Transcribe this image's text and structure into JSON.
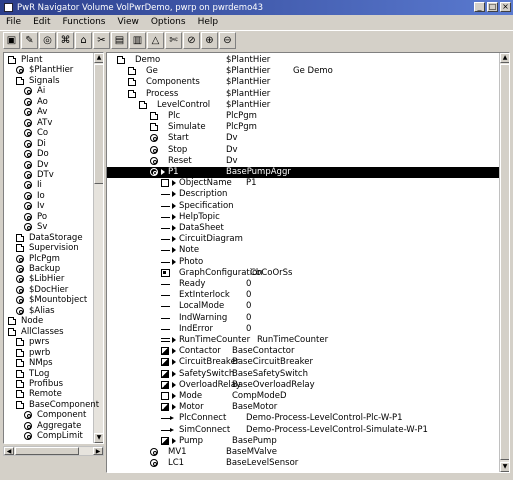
{
  "window": {
    "title": "PwR Navigator Volume VolPwrDemo, pwrp on pwrdemo43",
    "buttons": [
      "_",
      "□",
      "×"
    ]
  },
  "menu": [
    "File",
    "Edit",
    "Functions",
    "View",
    "Options",
    "Help"
  ],
  "toolbar": [
    {
      "icon": "save-icon",
      "glyph": "▣"
    },
    {
      "icon": "edit-icon",
      "glyph": "✎"
    },
    {
      "icon": "open-object-icon",
      "glyph": "◎"
    },
    {
      "icon": "object-graph-icon",
      "glyph": "⌘"
    },
    {
      "icon": "trace-icon",
      "glyph": "⌂"
    },
    {
      "icon": "plant-icon",
      "glyph": "✂"
    },
    {
      "icon": "lock-icon",
      "glyph": "▤"
    },
    {
      "icon": "crossref-icon",
      "glyph": "▥"
    },
    {
      "icon": "alarm-icon",
      "glyph": "△"
    },
    {
      "icon": "cut-icon",
      "glyph": "✄"
    },
    {
      "icon": "zoom-reset-icon",
      "glyph": "⊘"
    },
    {
      "icon": "zoom-in-icon",
      "glyph": "⊕"
    },
    {
      "icon": "zoom-out-icon",
      "glyph": "⊖"
    }
  ],
  "left_tree": [
    {
      "indent": 0,
      "icon": "folder",
      "label": "Plant"
    },
    {
      "indent": 1,
      "icon": "obj",
      "label": "$PlantHier"
    },
    {
      "indent": 1,
      "icon": "folder",
      "label": "Signals"
    },
    {
      "indent": 2,
      "icon": "obj",
      "label": "Ai"
    },
    {
      "indent": 2,
      "icon": "obj",
      "label": "Ao"
    },
    {
      "indent": 2,
      "icon": "obj",
      "label": "Av"
    },
    {
      "indent": 2,
      "icon": "obj",
      "label": "ATv"
    },
    {
      "indent": 2,
      "icon": "obj",
      "label": "Co"
    },
    {
      "indent": 2,
      "icon": "obj",
      "label": "Di"
    },
    {
      "indent": 2,
      "icon": "obj",
      "label": "Do"
    },
    {
      "indent": 2,
      "icon": "obj",
      "label": "Dv"
    },
    {
      "indent": 2,
      "icon": "obj",
      "label": "DTv"
    },
    {
      "indent": 2,
      "icon": "obj",
      "label": "Ii"
    },
    {
      "indent": 2,
      "icon": "obj",
      "label": "Io"
    },
    {
      "indent": 2,
      "icon": "obj",
      "label": "Iv"
    },
    {
      "indent": 2,
      "icon": "obj",
      "label": "Po"
    },
    {
      "indent": 2,
      "icon": "obj",
      "label": "Sv"
    },
    {
      "indent": 1,
      "icon": "folder",
      "label": "DataStorage"
    },
    {
      "indent": 1,
      "icon": "folder",
      "label": "Supervision"
    },
    {
      "indent": 1,
      "icon": "obj",
      "label": "PlcPgm"
    },
    {
      "indent": 1,
      "icon": "obj",
      "label": "Backup"
    },
    {
      "indent": 1,
      "icon": "obj",
      "label": "$LibHier"
    },
    {
      "indent": 1,
      "icon": "obj",
      "label": "$DocHier"
    },
    {
      "indent": 1,
      "icon": "obj",
      "label": "$Mountobject"
    },
    {
      "indent": 1,
      "icon": "obj",
      "label": "$Alias"
    },
    {
      "indent": 0,
      "icon": "folder",
      "label": "Node"
    },
    {
      "indent": 0,
      "icon": "folder",
      "label": "AllClasses"
    },
    {
      "indent": 1,
      "icon": "folder",
      "label": "pwrs"
    },
    {
      "indent": 1,
      "icon": "folder",
      "label": "pwrb"
    },
    {
      "indent": 1,
      "icon": "folder",
      "label": "NMps"
    },
    {
      "indent": 1,
      "icon": "folder",
      "label": "TLog"
    },
    {
      "indent": 1,
      "icon": "folder",
      "label": "Profibus"
    },
    {
      "indent": 1,
      "icon": "folder",
      "label": "Remote"
    },
    {
      "indent": 1,
      "icon": "folder",
      "label": "BaseComponent"
    },
    {
      "indent": 2,
      "icon": "obj",
      "label": "Component"
    },
    {
      "indent": 2,
      "icon": "obj",
      "label": "Aggregate"
    },
    {
      "indent": 2,
      "icon": "obj",
      "label": "CompLimit"
    }
  ],
  "right_tree": [
    {
      "indent": 0,
      "tri": false,
      "icon": "folder",
      "name": "Demo",
      "cls": "$PlantHier",
      "val": ""
    },
    {
      "indent": 1,
      "tri": false,
      "icon": "folder",
      "name": "Ge",
      "cls": "$PlantHier",
      "val": "Ge Demo"
    },
    {
      "indent": 1,
      "tri": false,
      "icon": "folder",
      "name": "Components",
      "cls": "$PlantHier",
      "val": ""
    },
    {
      "indent": 1,
      "tri": false,
      "icon": "folder",
      "name": "Process",
      "cls": "$PlantHier",
      "val": ""
    },
    {
      "indent": 2,
      "tri": false,
      "icon": "folder",
      "name": "LevelControl",
      "cls": "$PlantHier",
      "val": ""
    },
    {
      "indent": 3,
      "tri": false,
      "icon": "folder",
      "name": "Plc",
      "cls": "PlcPgm",
      "val": ""
    },
    {
      "indent": 3,
      "tri": false,
      "icon": "folder",
      "name": "Simulate",
      "cls": "PlcPgm",
      "val": ""
    },
    {
      "indent": 3,
      "tri": false,
      "icon": "obj",
      "name": "Start",
      "cls": "Dv",
      "val": ""
    },
    {
      "indent": 3,
      "tri": false,
      "icon": "obj",
      "name": "Stop",
      "cls": "Dv",
      "val": ""
    },
    {
      "indent": 3,
      "tri": false,
      "icon": "obj",
      "name": "Reset",
      "cls": "Dv",
      "val": ""
    },
    {
      "indent": 3,
      "tri": true,
      "icon": "obj",
      "name": "P1",
      "cls": "BasePumpAggr",
      "val": "",
      "selected": true
    },
    {
      "indent": 4,
      "tri": true,
      "icon": "doc",
      "name": "ObjectName",
      "cls": "",
      "val": "P1",
      "attr": true
    },
    {
      "indent": 4,
      "tri": true,
      "icon": "line",
      "name": "Description",
      "cls": "",
      "val": "",
      "attr": true
    },
    {
      "indent": 4,
      "tri": true,
      "icon": "line",
      "name": "Specification",
      "cls": "",
      "val": "",
      "attr": true
    },
    {
      "indent": 4,
      "tri": true,
      "icon": "line",
      "name": "HelpTopic",
      "cls": "",
      "val": "",
      "attr": true
    },
    {
      "indent": 4,
      "tri": true,
      "icon": "line",
      "name": "DataSheet",
      "cls": "",
      "val": "",
      "attr": true
    },
    {
      "indent": 4,
      "tri": true,
      "icon": "line",
      "name": "CircuitDiagram",
      "cls": "",
      "val": "",
      "attr": true
    },
    {
      "indent": 4,
      "tri": true,
      "icon": "line",
      "name": "Note",
      "cls": "",
      "val": "",
      "attr": true
    },
    {
      "indent": 4,
      "tri": true,
      "icon": "line",
      "name": "Photo",
      "cls": "",
      "val": "",
      "attr": true
    },
    {
      "indent": 4,
      "tri": false,
      "icon": "gc",
      "name": "GraphConfiguration",
      "cls": "",
      "val": "CbCoOrSs",
      "attr": true
    },
    {
      "indent": 4,
      "tri": false,
      "icon": "line",
      "name": "Ready",
      "cls": "",
      "val": "0",
      "attr": true
    },
    {
      "indent": 4,
      "tri": false,
      "icon": "line",
      "name": "ExtInterlock",
      "cls": "",
      "val": "0",
      "attr": true
    },
    {
      "indent": 4,
      "tri": false,
      "icon": "line",
      "name": "LocalMode",
      "cls": "",
      "val": "0",
      "attr": true
    },
    {
      "indent": 4,
      "tri": false,
      "icon": "line",
      "name": "IndWarning",
      "cls": "",
      "val": "0",
      "attr": true
    },
    {
      "indent": 4,
      "tri": false,
      "icon": "line",
      "name": "IndError",
      "cls": "",
      "val": "0",
      "attr": true
    },
    {
      "indent": 4,
      "tri": true,
      "icon": "attrlist",
      "name": "RunTimeCounter",
      "cls": "",
      "val": "RunTimeCounter",
      "attr": true
    },
    {
      "indent": 4,
      "tri": true,
      "icon": "bw",
      "name": "Contactor",
      "cls": "",
      "val": "BaseContactor",
      "attr": true
    },
    {
      "indent": 4,
      "tri": true,
      "icon": "bw",
      "name": "CircuitBreaker",
      "cls": "",
      "val": "BaseCircuitBreaker",
      "attr": true
    },
    {
      "indent": 4,
      "tri": true,
      "icon": "bw",
      "name": "SafetySwitch",
      "cls": "",
      "val": "BaseSafetySwitch",
      "attr": true
    },
    {
      "indent": 4,
      "tri": true,
      "icon": "bw",
      "name": "OverloadRelay",
      "cls": "",
      "val": "BaseOverloadRelay",
      "attr": true
    },
    {
      "indent": 4,
      "tri": true,
      "icon": "doc",
      "name": "Mode",
      "cls": "",
      "val": "CompModeD",
      "attr": true
    },
    {
      "indent": 4,
      "tri": true,
      "icon": "bw",
      "name": "Motor",
      "cls": "",
      "val": "BaseMotor",
      "attr": true
    },
    {
      "indent": 4,
      "tri": false,
      "icon": "link",
      "name": "PlcConnect",
      "cls": "",
      "val": "Demo-Process-LevelControl-Plc-W-P1",
      "attr": true
    },
    {
      "indent": 4,
      "tri": false,
      "icon": "link",
      "name": "SimConnect",
      "cls": "",
      "val": "Demo-Process-LevelControl-Simulate-W-P1",
      "attr": true
    },
    {
      "indent": 4,
      "tri": true,
      "icon": "bw",
      "name": "Pump",
      "cls": "",
      "val": "BasePump",
      "attr": true
    },
    {
      "indent": 3,
      "tri": false,
      "icon": "obj",
      "name": "MV1",
      "cls": "BaseMValve",
      "val": ""
    },
    {
      "indent": 3,
      "tri": false,
      "icon": "obj",
      "name": "LC1",
      "cls": "BaseLevelSensor",
      "val": ""
    }
  ]
}
